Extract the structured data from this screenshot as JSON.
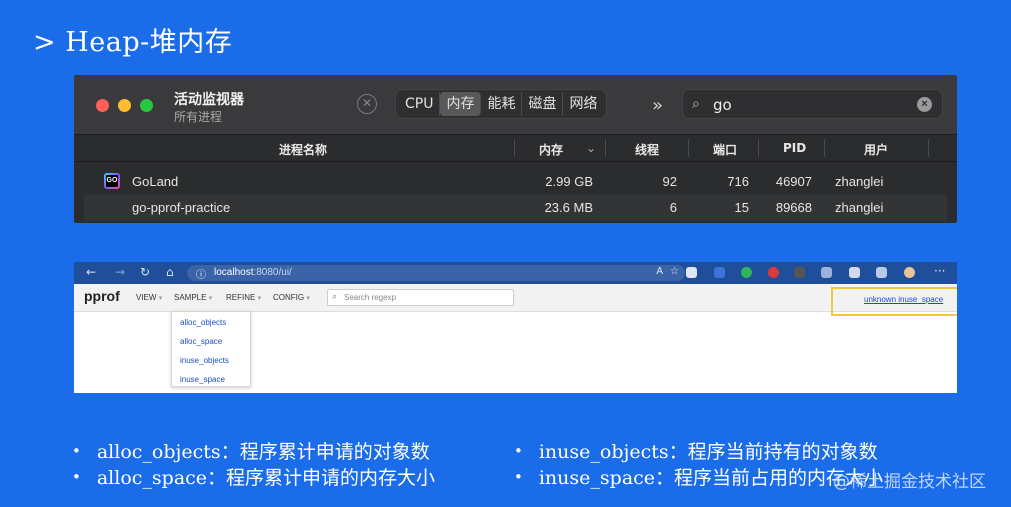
{
  "slide": {
    "title": "> Heap-堆内存"
  },
  "activity_monitor": {
    "title": "活动监视器",
    "subtitle": "所有进程",
    "tabs": [
      "CPU",
      "内存",
      "能耗",
      "磁盘",
      "网络"
    ],
    "active_tab": "内存",
    "search_value": "go",
    "columns": [
      "进程名称",
      "内存",
      "线程",
      "端口",
      "PID",
      "用户"
    ],
    "rows": [
      {
        "name": "GoLand",
        "memory": "2.99 GB",
        "threads": "92",
        "ports": "716",
        "pid": "46907",
        "user": "zhanglei"
      },
      {
        "name": "go-pprof-practice",
        "memory": "23.6 MB",
        "threads": "6",
        "ports": "15",
        "pid": "89668",
        "user": "zhanglei"
      }
    ],
    "colors": {
      "close": "#ff5f57",
      "minimize": "#febc2e",
      "zoom": "#28c840"
    }
  },
  "browser": {
    "url_host": "localhost",
    "url_rest": ":8080/ui/",
    "app_title": "pprof",
    "menus": [
      "VIEW",
      "SAMPLE",
      "REFINE",
      "CONFIG"
    ],
    "search_placeholder": "Search regexp",
    "sample_type_link": "unknown inuse_space",
    "sample_options": [
      "alloc_objects",
      "alloc_space",
      "inuse_objects",
      "inuse_space"
    ]
  },
  "bullets": {
    "left": [
      {
        "term": "alloc_objects：",
        "desc": "程序累计申请的对象数"
      },
      {
        "term": "alloc_space：",
        "desc": "程序累计申请的内存大小"
      }
    ],
    "right": [
      {
        "term": "inuse_objects：",
        "desc": "程序当前持有的对象数"
      },
      {
        "term": "inuse_space：",
        "desc": "程序当前占用的内存大小"
      }
    ]
  },
  "watermark": "@稀土掘金技术社区"
}
